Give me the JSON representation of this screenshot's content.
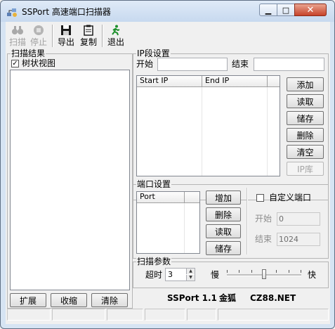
{
  "window": {
    "title": "SSPort 高速端口扫描器"
  },
  "toolbar": {
    "scan": "扫描",
    "stop": "停止",
    "export": "导出",
    "copy": "复制",
    "exit": "退出"
  },
  "scan_results": {
    "group_label": "扫描结果",
    "tree_view_label": "树状视图",
    "tree_view_checked": true,
    "expand": "扩展",
    "collapse": "收缩",
    "clear": "清除"
  },
  "ip_range": {
    "group_label": "IP段设置",
    "start_label": "开始",
    "start_value": "",
    "end_label": "结束",
    "end_value": "",
    "columns": [
      "Start IP",
      "End IP"
    ],
    "buttons": {
      "add": "添加",
      "read": "读取",
      "save": "储存",
      "delete": "删除",
      "clear": "清空",
      "ip_lib": "IP库"
    }
  },
  "port_settings": {
    "group_label": "端口设置",
    "columns": [
      "Port"
    ],
    "buttons": {
      "add": "增加",
      "delete": "删除",
      "read": "读取",
      "save": "储存"
    },
    "custom_port_label": "自定义端口",
    "custom_port_checked": false,
    "start_label": "开始",
    "start_value": "0",
    "end_label": "结束",
    "end_value": "1024"
  },
  "scan_params": {
    "group_label": "扫描参数",
    "timeout_label": "超时",
    "timeout_value": "3",
    "slow_label": "慢",
    "fast_label": "快",
    "speed_level": 0.5
  },
  "footer": {
    "version": "SSPort 1.1",
    "author": "金狐",
    "site": "CZ88.NET"
  }
}
